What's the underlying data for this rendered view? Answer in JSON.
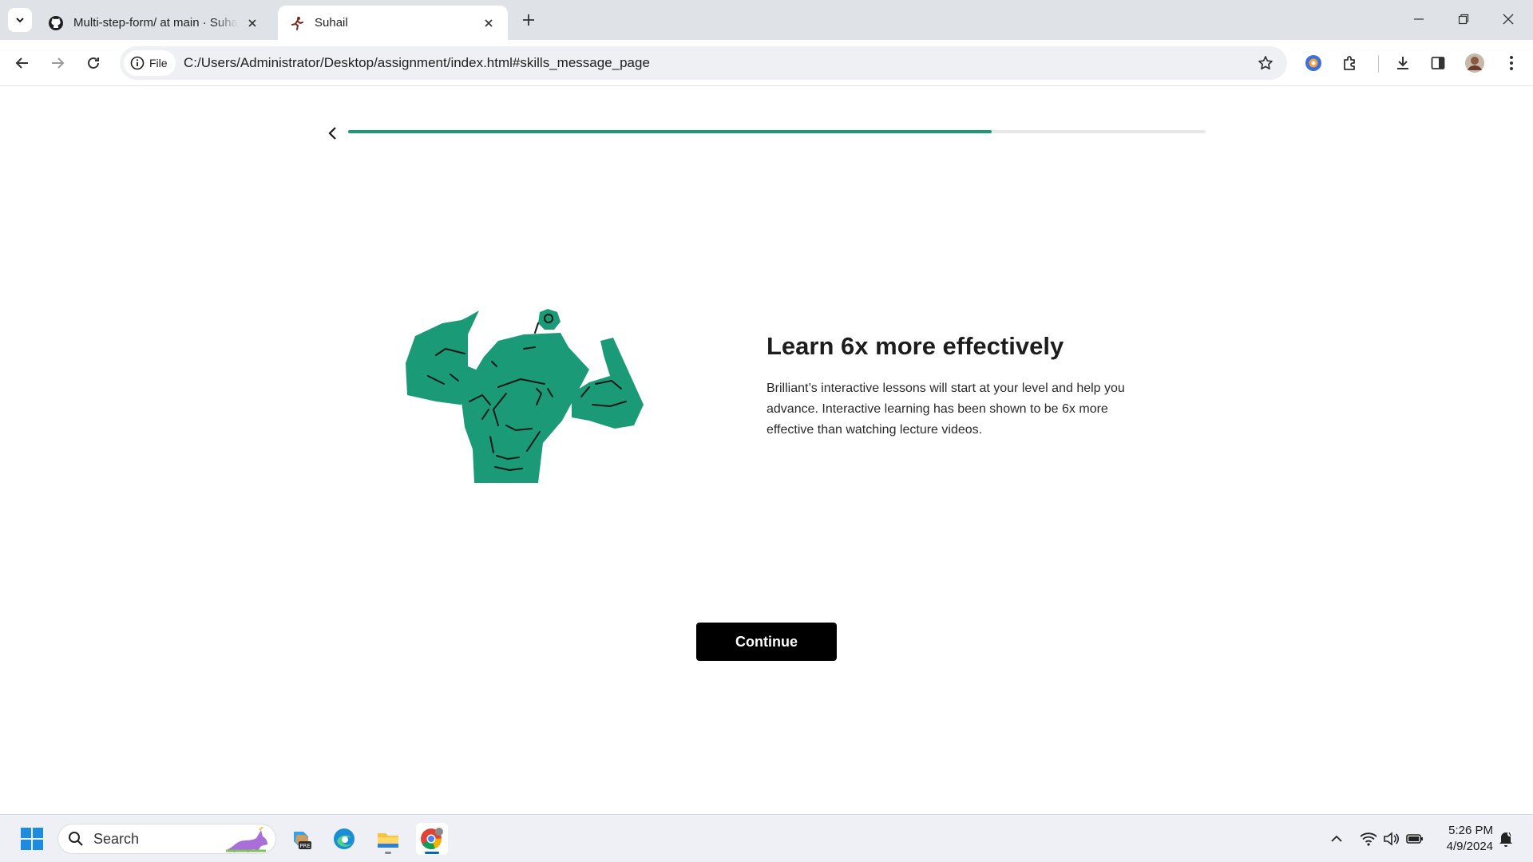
{
  "browser": {
    "tabs": [
      {
        "title": "Multi-step-form/ at main · Suhail",
        "favicon": "github-icon",
        "active": false
      },
      {
        "title": "Suhail",
        "favicon": "runner-icon",
        "active": true
      }
    ],
    "site_chip_label": "File",
    "url": "C:/Users/Administrator/Desktop/assignment/index.html#skills_message_page"
  },
  "page": {
    "progress_fraction": 0.75,
    "accent_color": "#1b9a78",
    "illustration": "muscular-figure-illustration",
    "headline": "Learn 6x more effectively",
    "body": "Brilliant’s interactive lessons will start at your level and help you advance. Interactive learning has been shown to be 6x more effective than watching lecture videos.",
    "continue_label": "Continue"
  },
  "taskbar": {
    "search_placeholder": "Search",
    "apps": [
      "windows-start-icon",
      "copilot-icon",
      "edge-icon",
      "file-explorer-icon",
      "chrome-icon"
    ],
    "clock_time": "5:26 PM",
    "clock_date": "4/9/2024"
  }
}
